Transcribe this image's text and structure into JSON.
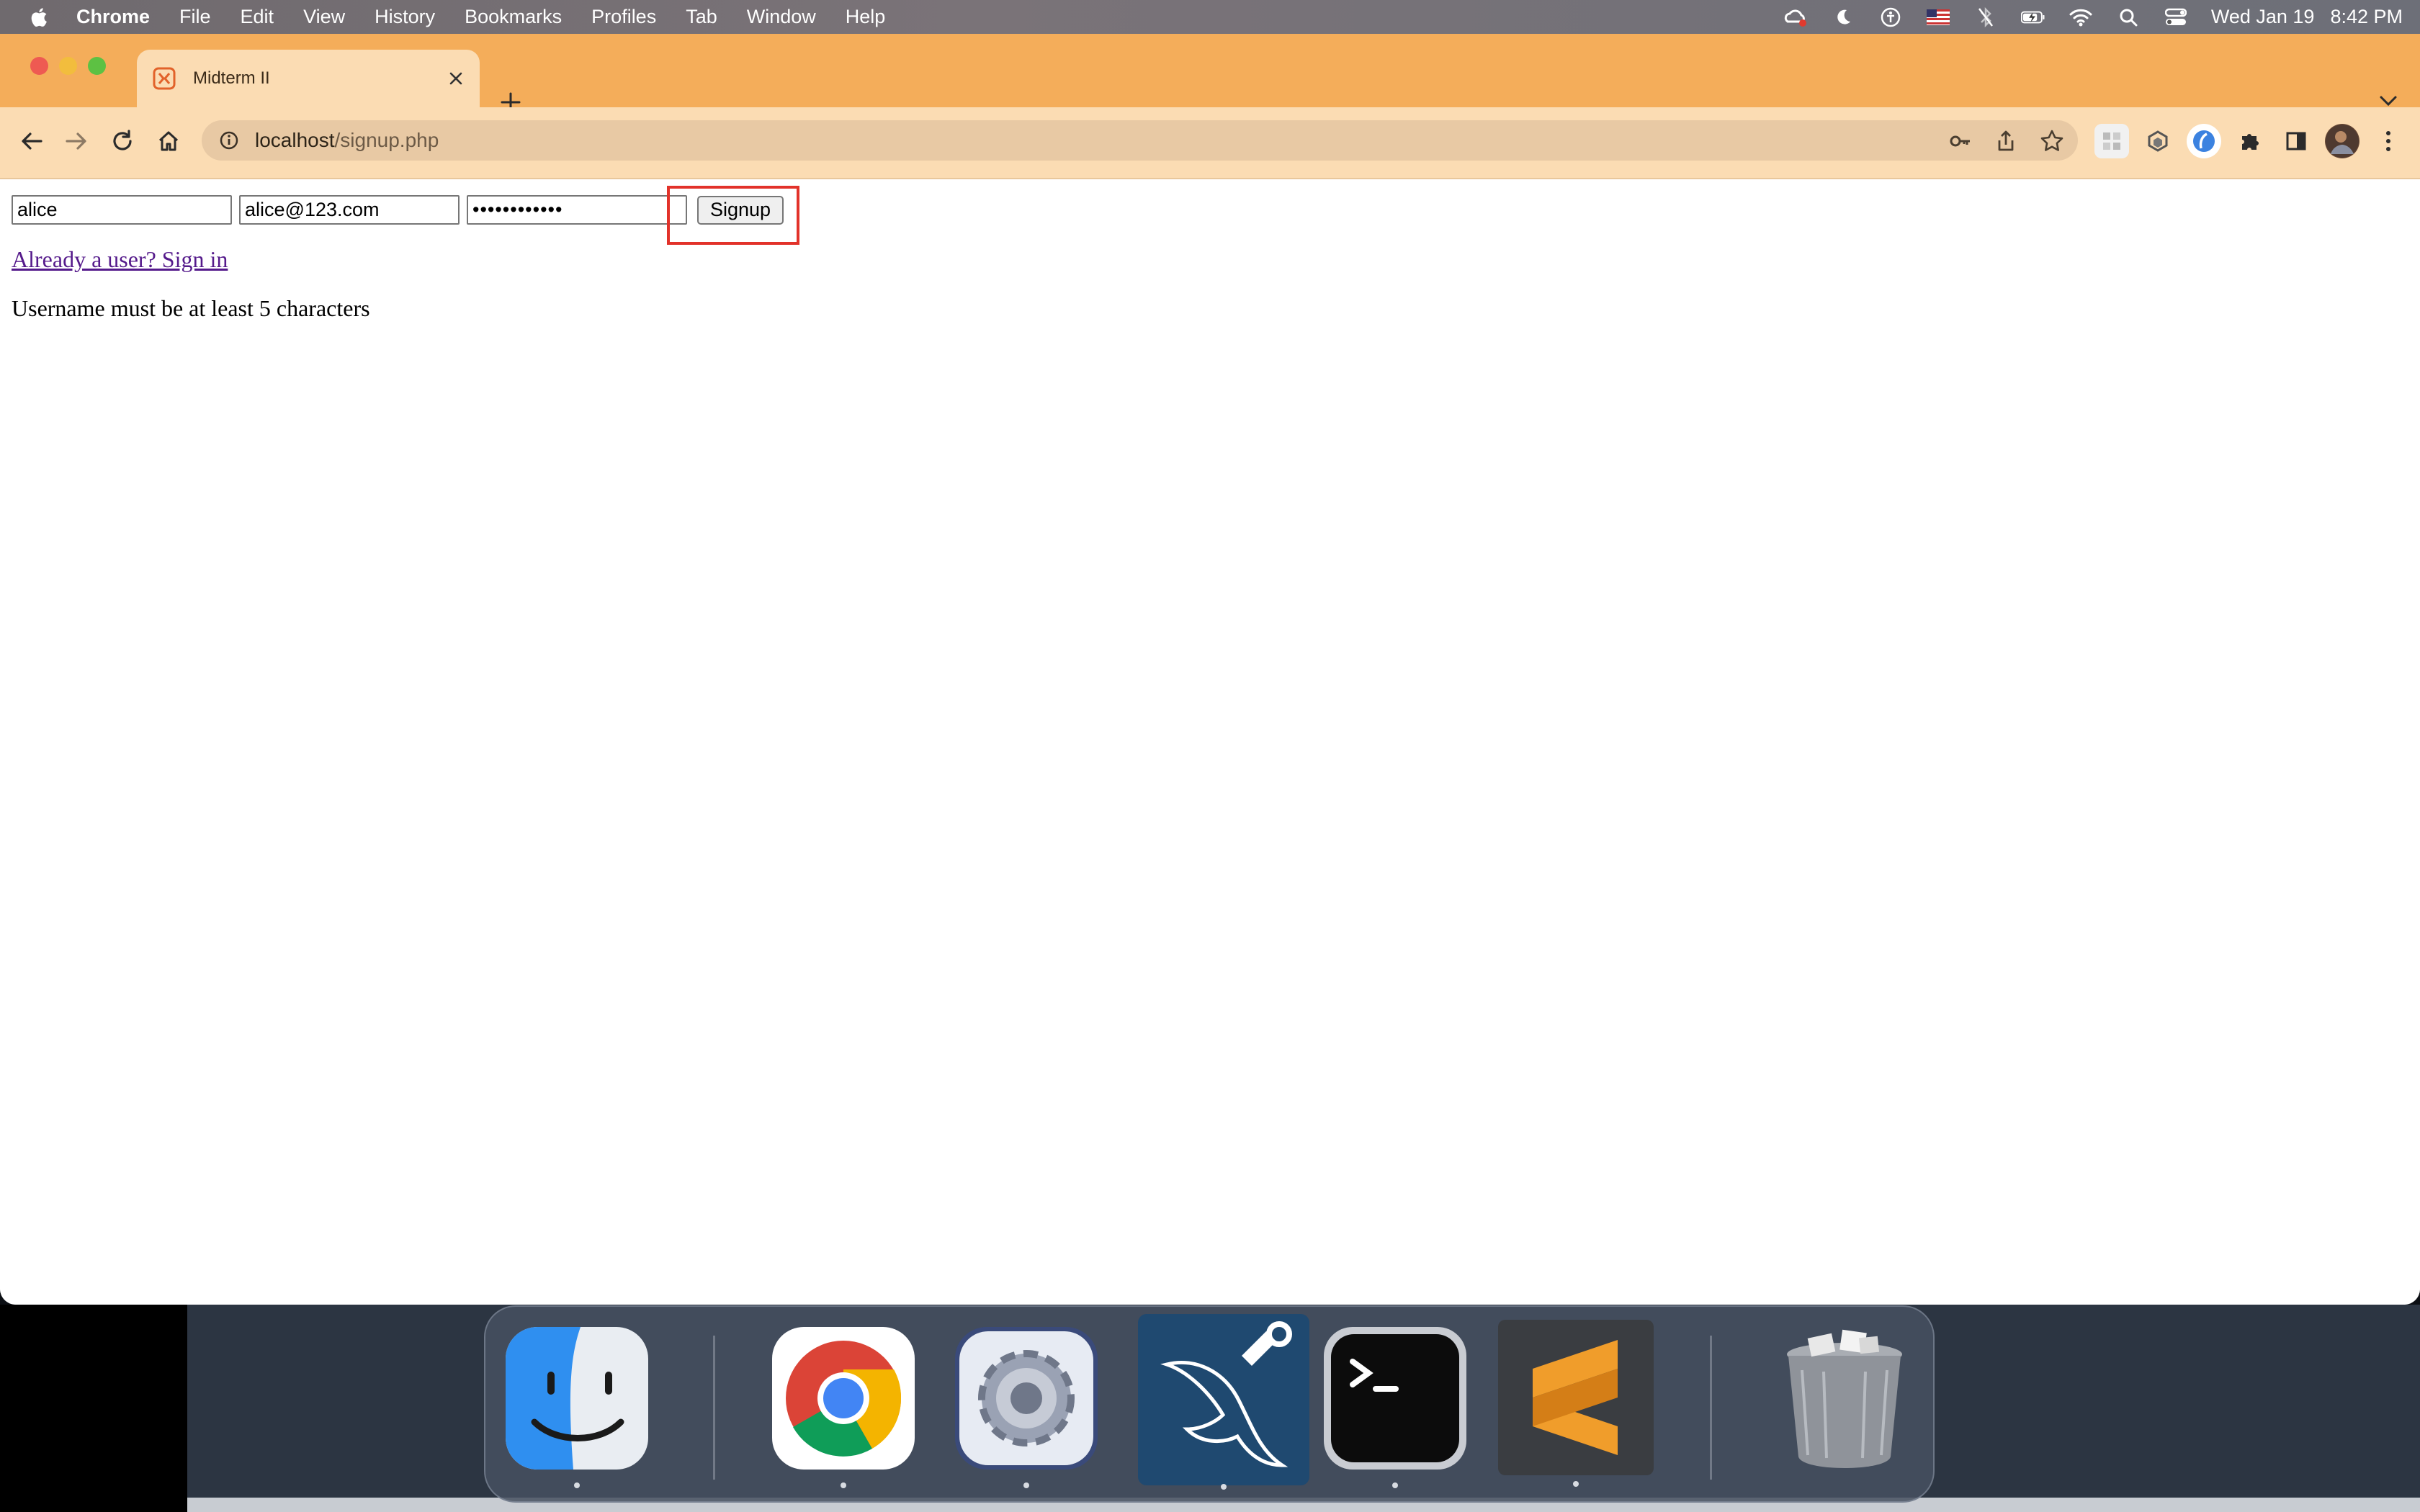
{
  "menubar": {
    "app_name": "Chrome",
    "items": [
      "File",
      "Edit",
      "View",
      "History",
      "Bookmarks",
      "Profiles",
      "Tab",
      "Window",
      "Help"
    ],
    "date": "Wed Jan 19",
    "time": "8:42 PM",
    "status_icons": [
      "creative-cloud-icon",
      "moon-icon",
      "accessibility-icon",
      "us-flag-icon",
      "bluetooth-off-icon",
      "battery-charging-icon",
      "wifi-icon",
      "spotlight-search-icon",
      "control-center-icon"
    ]
  },
  "browser": {
    "tab": {
      "title": "Midterm II"
    },
    "url": {
      "host": "localhost",
      "path": "/signup.php"
    }
  },
  "page": {
    "username_value": "alice",
    "email_value": "alice@123.com",
    "password_value": "••••••••••••",
    "signup_label": "Signup",
    "signin_link": "Already a user? Sign in",
    "error_message": "Username must be at least 5 characters"
  },
  "dock": {
    "apps": [
      "Finder",
      "Google Chrome",
      "System Preferences",
      "MySQL Workbench",
      "Terminal",
      "Sublime Text",
      "Trash"
    ]
  },
  "colors": {
    "tabstrip": "#f4ad5a",
    "toolbar": "#fbdcb3",
    "highlight": "#e2322a",
    "visited_link": "#551a8b"
  }
}
